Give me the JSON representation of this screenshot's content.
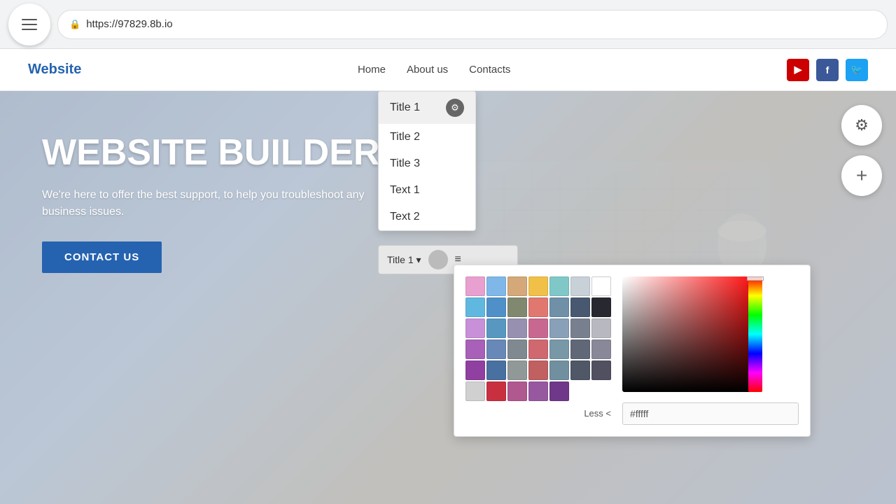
{
  "browser": {
    "url": "https://97829.8b.io",
    "url_prefix": "🔒",
    "menu_label": "Menu"
  },
  "header": {
    "logo": "Website",
    "nav": [
      {
        "label": "Home",
        "id": "home"
      },
      {
        "label": "About us",
        "id": "about"
      },
      {
        "label": "Contacts",
        "id": "contacts"
      }
    ],
    "social": [
      {
        "label": "YouTube",
        "short": "▶",
        "class": "yt"
      },
      {
        "label": "Facebook",
        "short": "f",
        "class": "fb"
      },
      {
        "label": "Twitter",
        "short": "🐦",
        "class": "tw"
      }
    ]
  },
  "hero": {
    "title": "WEBSITE BUILDER",
    "subtitle": "We're here to offer the best support, to help you troubleshoot any business issues.",
    "cta_label": "CONTACT US"
  },
  "float_buttons": {
    "settings_label": "⚙",
    "add_label": "+"
  },
  "dropdown": {
    "items": [
      {
        "label": "Title 1",
        "active": true
      },
      {
        "label": "Title 2",
        "active": false
      },
      {
        "label": "Title 3",
        "active": false
      },
      {
        "label": "Text 1",
        "active": false
      },
      {
        "label": "Text 2",
        "active": false
      }
    ]
  },
  "toolbar": {
    "selected": "Title 1",
    "toggle_color": "#bbb"
  },
  "color_picker": {
    "swatches_row1": [
      "#e8a0d0",
      "#7fb8e8",
      "#d0a070",
      "#f0c048",
      "#80c8c8",
      "#c8d0d8",
      "#ffffff"
    ],
    "swatches_row2": [
      "#60b8e0",
      "#5090c8",
      "#808870",
      "#e07870",
      "#7090a8",
      "#485870",
      "#282830"
    ],
    "swatches_row3": [
      "#c890d8",
      "#5898c0",
      "#9890b0",
      "#c86890",
      "#88a0b8",
      "#788090",
      "#b8b8c0"
    ],
    "swatches_row4": [
      "#a860b8",
      "#6888b8",
      "#808890",
      "#d06870",
      "#7898a8",
      "#606878",
      "#888898"
    ],
    "swatches_row5": [
      "#9040a0",
      "#4870a0",
      "#909898",
      "#c06060",
      "#7090a0",
      "#505868",
      "#505060"
    ],
    "swatches_extra": [
      "#d0d0d0",
      "#c83040",
      "#b05890",
      "#9858a0",
      "#703888"
    ],
    "less_label": "Less <",
    "hex_value": "#fffff"
  }
}
